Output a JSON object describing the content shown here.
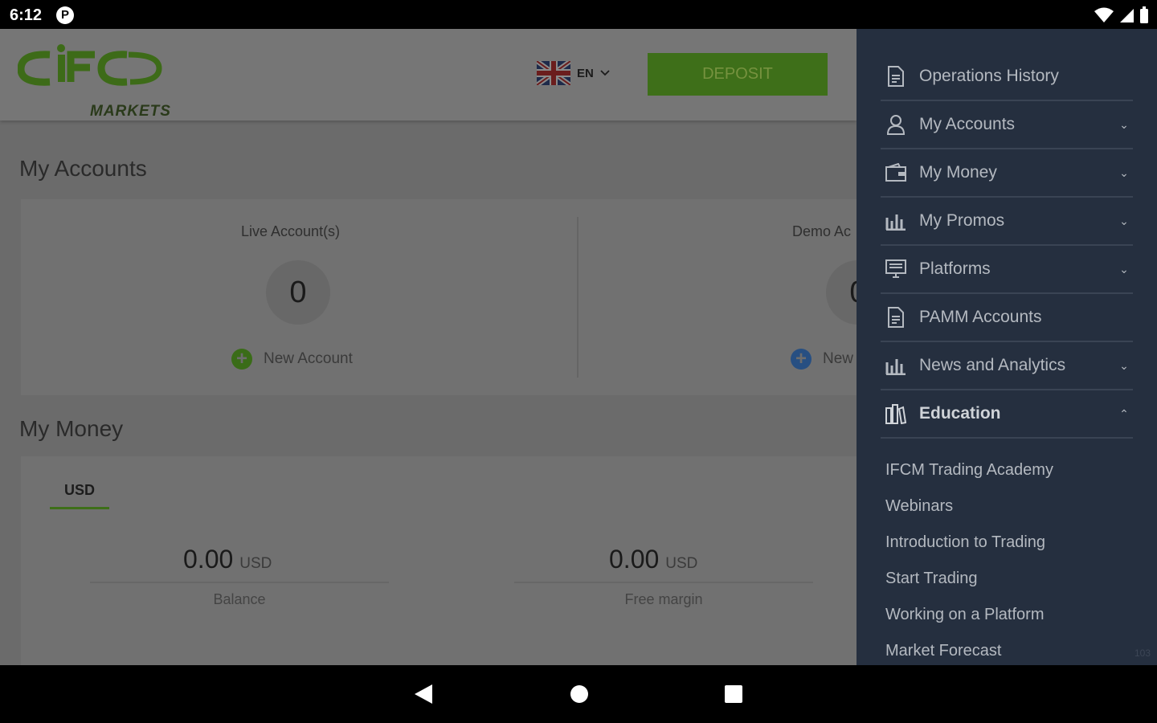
{
  "status_bar": {
    "time": "6:12",
    "notification_icon_letter": "P"
  },
  "header": {
    "logo_text": "IFC",
    "logo_subtext": "MARKETS",
    "language": "EN",
    "deposit_label": "DEPOSIT",
    "accent_color": "#3e6f19"
  },
  "my_accounts": {
    "title": "My Accounts",
    "live": {
      "label": "Live Account(s)",
      "count": "0",
      "new_label": "New Account"
    },
    "demo": {
      "label": "Demo Ac",
      "count": "0",
      "new_label": "New"
    }
  },
  "my_money": {
    "title": "My Money",
    "tab": "USD",
    "balance": {
      "value": "0.00",
      "unit": "USD",
      "label": "Balance"
    },
    "free_margin": {
      "value": "0.00",
      "unit": "USD",
      "label": "Free margin"
    }
  },
  "drawer": {
    "items": [
      {
        "label": "Operations History",
        "icon": "document-icon",
        "chevron": ""
      },
      {
        "label": "My Accounts",
        "icon": "user-icon",
        "chevron": "⌄"
      },
      {
        "label": "My Money",
        "icon": "wallet-icon",
        "chevron": "⌄"
      },
      {
        "label": "My Promos",
        "icon": "bar-chart-icon",
        "chevron": "⌄"
      },
      {
        "label": "Platforms",
        "icon": "monitor-icon",
        "chevron": "⌄"
      },
      {
        "label": "PAMM Accounts",
        "icon": "document-icon",
        "chevron": ""
      },
      {
        "label": "News and Analytics",
        "icon": "bar-chart-icon",
        "chevron": "⌄"
      },
      {
        "label": "Education",
        "icon": "books-icon",
        "chevron": "⌃"
      }
    ],
    "education_sub": [
      "IFCM Trading Academy",
      "Webinars",
      "Introduction to Trading",
      "Start Trading",
      "Working on a Platform",
      "Market Forecast"
    ],
    "corner_text": "103"
  }
}
